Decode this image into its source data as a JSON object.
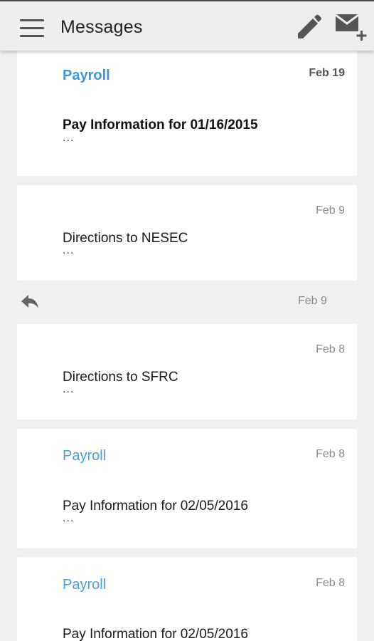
{
  "appbar": {
    "title": "Messages",
    "menu_icon": "hamburger-menu-icon",
    "compose_icon": "pencil-icon",
    "new_message_icon": "envelope-plus-icon"
  },
  "colors": {
    "accent": "#3a97de",
    "background": "#f0f0f0",
    "card": "#ffffff",
    "appbar": "#eeeeee"
  },
  "messages": [
    {
      "sender": "Payroll",
      "date": "Feb 19",
      "subject": "Pay Information for 01/16/2015",
      "preview": "...",
      "unread": true
    },
    {
      "sender": "",
      "date": "Feb 9",
      "subject": "Directions to NESEC",
      "preview": "..."
    },
    {
      "sender": "",
      "date": "Feb 8",
      "subject": "Directions to SFRC",
      "preview": "..."
    },
    {
      "sender": "Payroll",
      "date": "Feb 8",
      "subject": "Pay Information for 02/05/2016",
      "preview": "..."
    },
    {
      "sender": "Payroll",
      "date": "Feb 8",
      "subject": "Pay Information for 02/05/2016",
      "preview": "..."
    }
  ],
  "reply_row": {
    "date": "Feb 9",
    "icon": "reply-arrow-icon"
  }
}
